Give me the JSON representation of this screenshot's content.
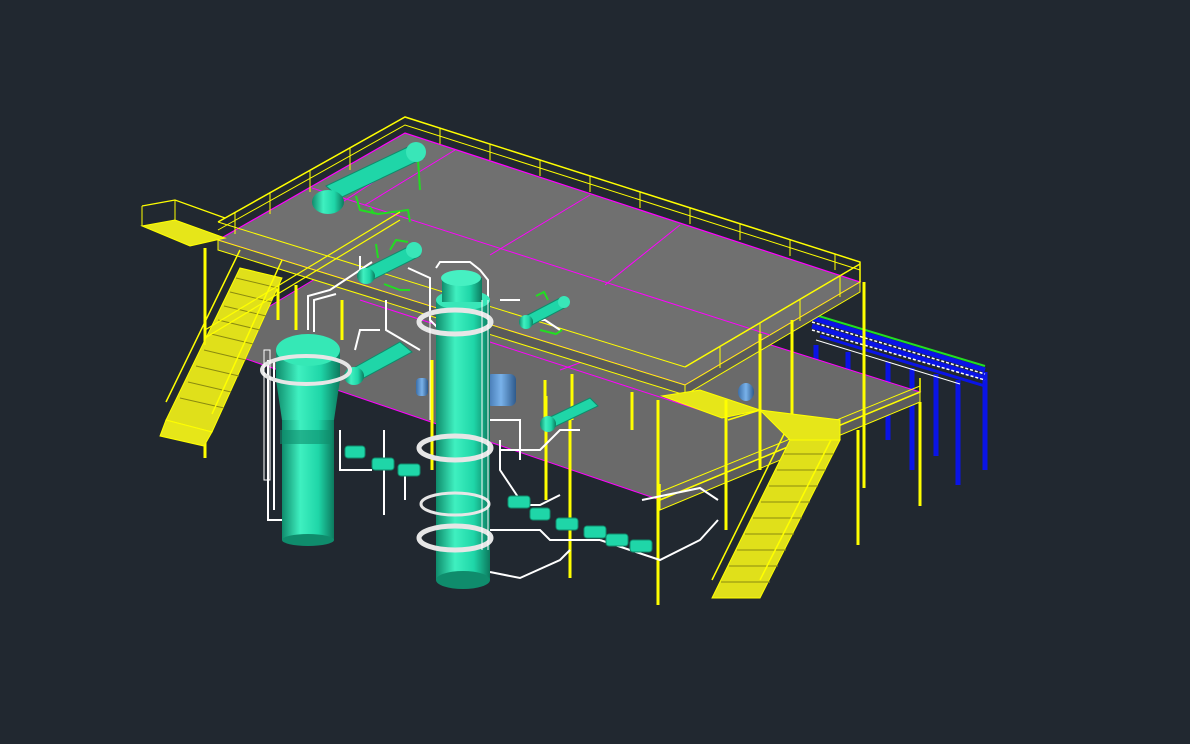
{
  "viewport": {
    "background": "#212830",
    "visible_text": []
  },
  "scene": {
    "description_free": true,
    "layer_colors": {
      "steel": "#ffff00",
      "deck": "#6e6e6e",
      "deck_edge": "#ff00ff",
      "vessel": "#1fd6a8",
      "vessel_shade": "#118a6e",
      "pipe": "#ffffff",
      "pipe_green": "#22dd22",
      "pipe_rack": "#0a14e6",
      "equipment_blue": "#4a8ac8"
    }
  }
}
